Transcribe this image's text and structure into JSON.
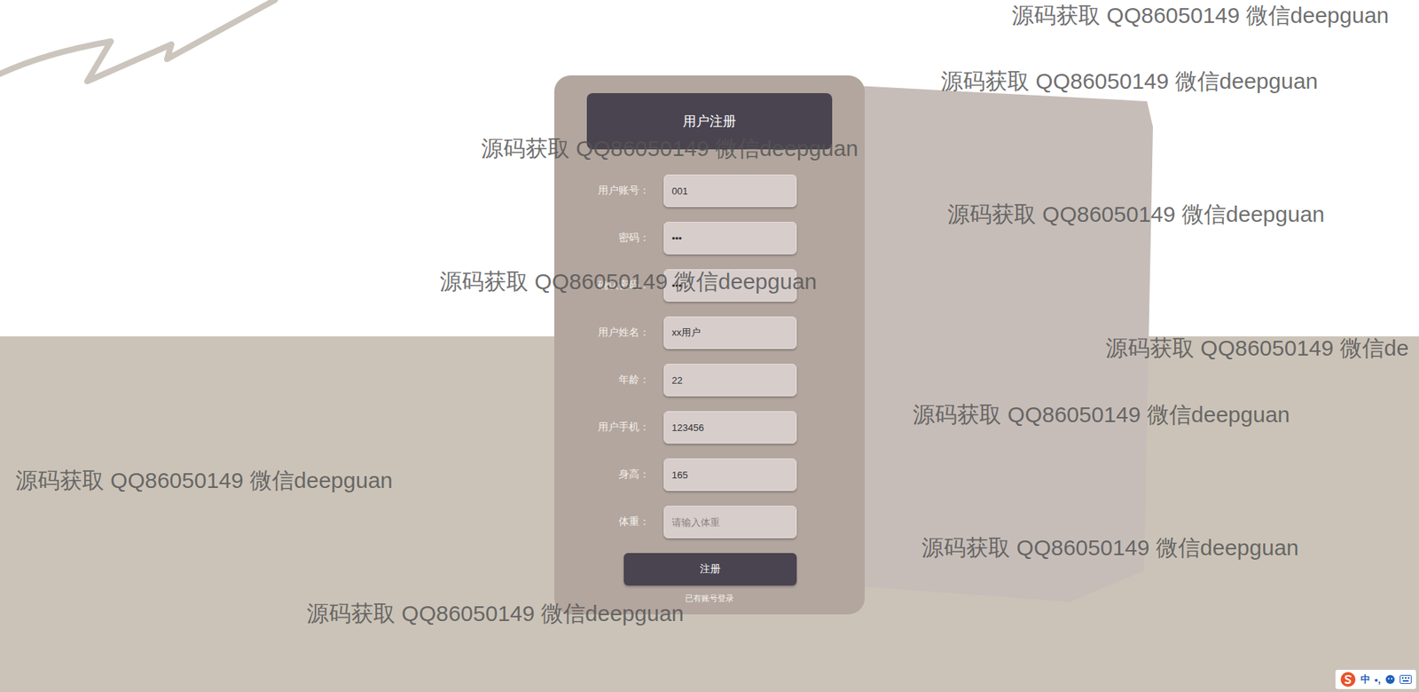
{
  "form": {
    "title": "用户注册",
    "fields": [
      {
        "label": "用户账号：",
        "value": "001"
      },
      {
        "label": "密码：",
        "value": "•••"
      },
      {
        "label": "确认密码：",
        "value": "•••"
      },
      {
        "label": "用户姓名：",
        "value": "xx用户"
      },
      {
        "label": "年龄：",
        "value": "22"
      },
      {
        "label": "用户手机：",
        "value": "123456"
      },
      {
        "label": "身高：",
        "value": "165"
      },
      {
        "label": "体重：",
        "value": "",
        "placeholder": "请输入体重"
      }
    ],
    "submit": "注册",
    "login_link": "已有账号登录"
  },
  "watermarks": [
    "源码获取 QQ86050149 微信deepguan",
    "源码获取 QQ86050149 微信deepguan",
    "源码获取 QQ86050149 微信deepguan",
    "源码获取 QQ86050149 微信deepguan",
    "源码获取 QQ86050149 微信deepguan",
    "源码获取 QQ86050149 微信de",
    "源码获取 QQ86050149 微信deepguan",
    "源码获取 QQ86050149 微信deepguan",
    "源码获取 QQ86050149 微信deepguan",
    "源码获取 QQ86050149 微信deepguan"
  ],
  "ime": {
    "mode": "中",
    "punct": "•,"
  }
}
